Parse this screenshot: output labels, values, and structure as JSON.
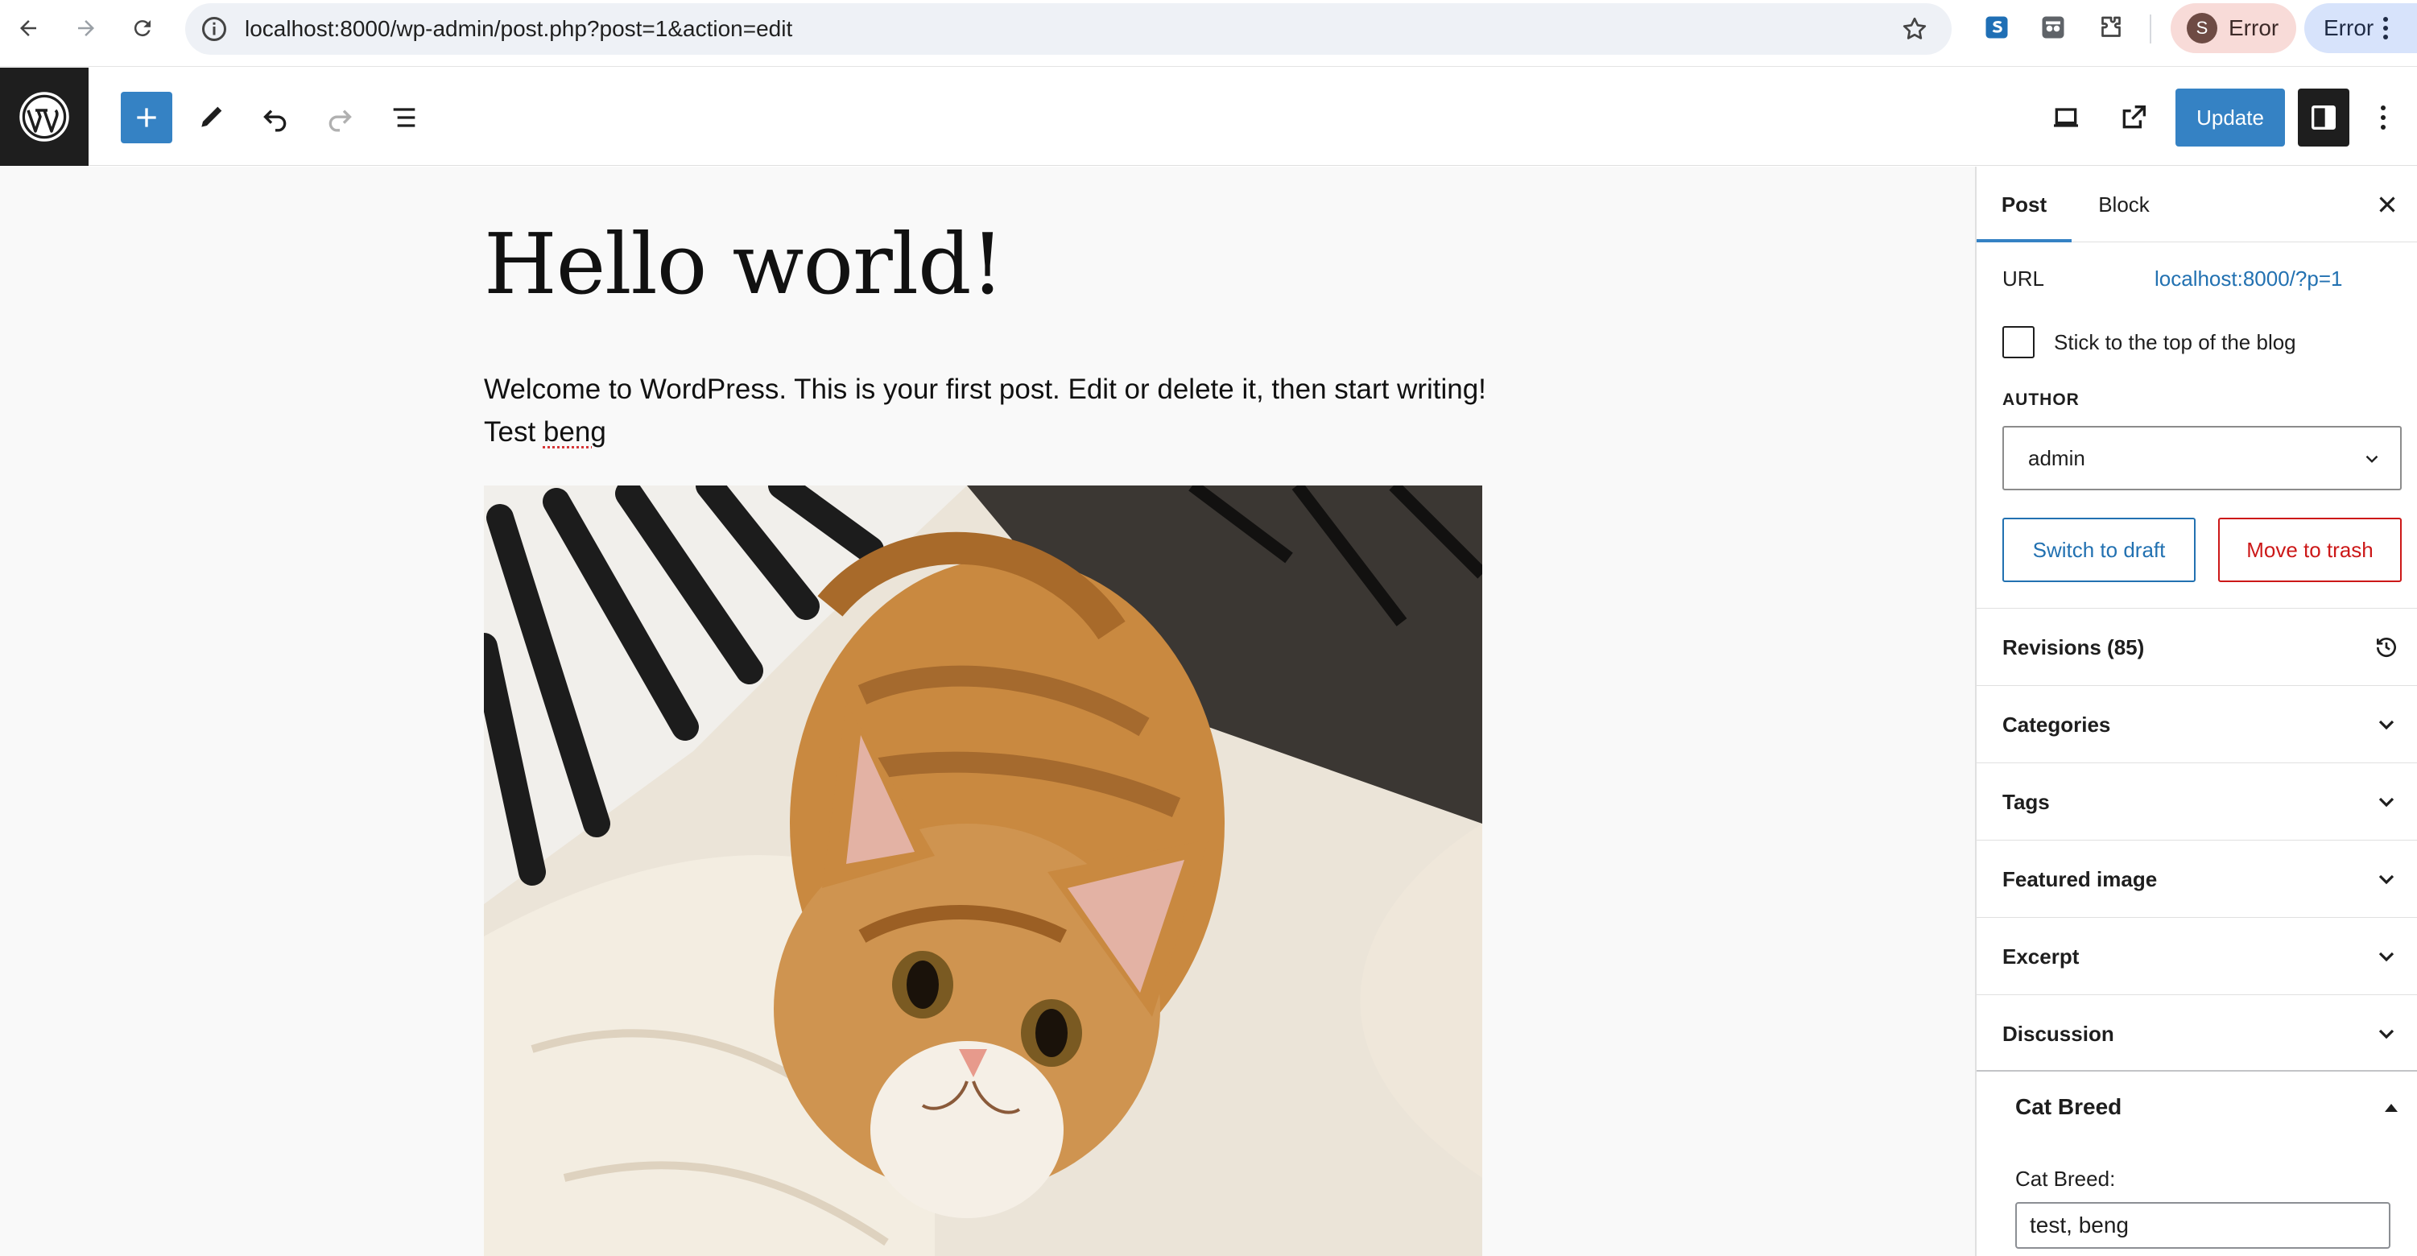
{
  "browser": {
    "url": "localhost:8000/wp-admin/post.php?post=1&action=edit",
    "profile_initial": "S",
    "profile_status": "Error",
    "sync_status": "Error"
  },
  "toolbar": {
    "update_label": "Update"
  },
  "post": {
    "title": "Hello world!",
    "body_text": "Welcome to WordPress. This is your first post. Edit or delete it, then start writing! Test ",
    "body_misspelled": "beng"
  },
  "sidebar": {
    "tabs": [
      "Post",
      "Block"
    ],
    "url_label": "URL",
    "url_value": "localhost:8000/?p=1",
    "sticky_label": "Stick to the top of the blog",
    "author_label": "AUTHOR",
    "author_value": "admin",
    "switch_draft_label": "Switch to draft",
    "move_trash_label": "Move to trash",
    "panels": [
      {
        "title": "Revisions (85)",
        "icon": "history-icon"
      },
      {
        "title": "Categories",
        "icon": "chevron-down-icon"
      },
      {
        "title": "Tags",
        "icon": "chevron-down-icon"
      },
      {
        "title": "Featured image",
        "icon": "chevron-down-icon"
      },
      {
        "title": "Excerpt",
        "icon": "chevron-down-icon"
      },
      {
        "title": "Discussion",
        "icon": "chevron-down-icon"
      }
    ],
    "meta_box": {
      "title": "Cat Breed",
      "field_label": "Cat Breed:",
      "field_value": "test, beng"
    }
  },
  "colors": {
    "wp_blue": "#3582c4",
    "link_blue": "#2271b1",
    "danger_red": "#cc1818",
    "toolbar_dark": "#1e1e1e",
    "canvas_bg": "#f9f9f9"
  }
}
